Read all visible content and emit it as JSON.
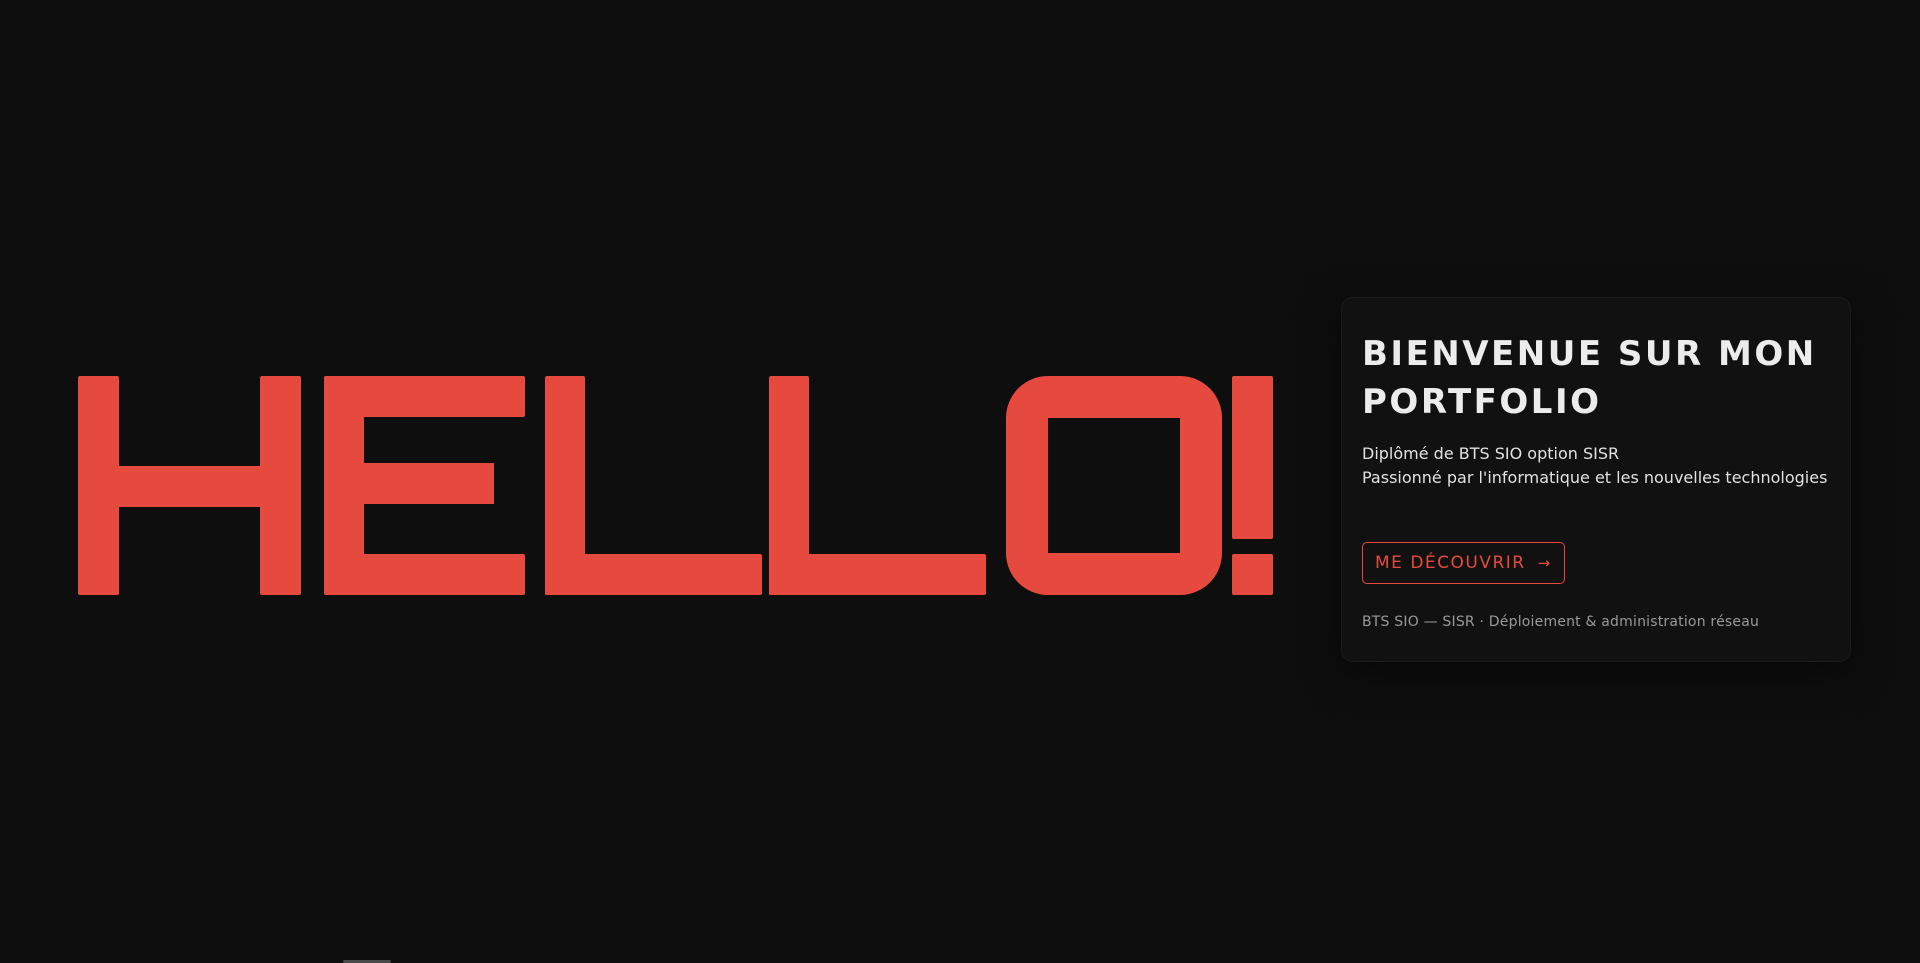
{
  "hero": {
    "big_word": "HELLO!",
    "accent_color": "#e64a3f",
    "background_color": "#0e0e0e"
  },
  "card": {
    "title_line1": "BIENVENUE SUR MON",
    "title_line2": "PORTFOLIO",
    "desc_line1": "Diplômé de BTS SIO option SISR",
    "desc_line2": "Passionné par l'informatique et les nouvelles technologies",
    "cta_label": "ME DÉCOUVRIR",
    "cta_icon": "arrow-right-icon",
    "footer": "BTS SIO — SISR · Déploiement & administration réseau"
  }
}
